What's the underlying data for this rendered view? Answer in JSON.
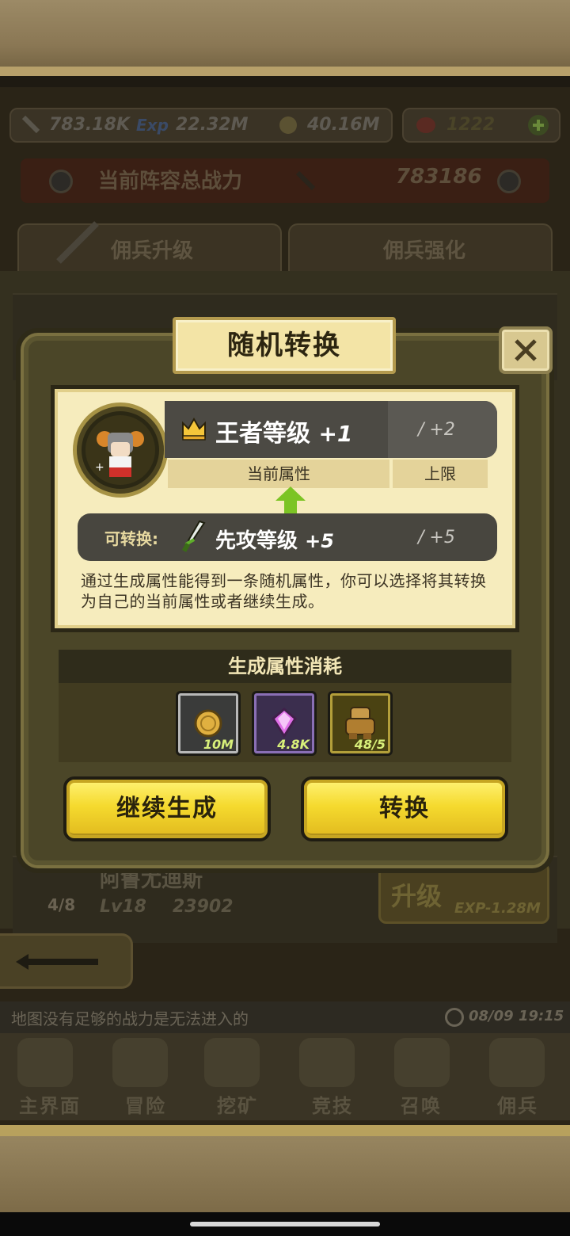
{
  "resources": {
    "power": "783.18K",
    "exp": "22.32M",
    "gold": "40.16M",
    "gems": "1222",
    "exp_tag": "Exp"
  },
  "team_power": {
    "label": "当前阵容总战力",
    "value": "783186"
  },
  "tabs": [
    {
      "label": "佣兵升级"
    },
    {
      "label": "佣兵强化"
    }
  ],
  "background_hero": {
    "name": "阿鲁尤迪斯",
    "count": "4/8",
    "level": "Lv18",
    "power": "23902",
    "upgrade_label": "升级",
    "upgrade_cost": "EXP-1.28M"
  },
  "tip": {
    "text": "地图没有足够的战力是无法进入的",
    "time": "08/09 19:15"
  },
  "bottom_nav": [
    {
      "label": "主界面",
      "icon": "map-scroll-icon"
    },
    {
      "label": "冒险",
      "icon": "island-icon"
    },
    {
      "label": "挖矿",
      "icon": "pickaxe-icon"
    },
    {
      "label": "竞技",
      "icon": "crossed-swords-icon"
    },
    {
      "label": "召唤",
      "icon": "scroll-icon"
    },
    {
      "label": "佣兵",
      "icon": "tent-icon"
    }
  ],
  "modal": {
    "title": "随机转换",
    "current_attr": {
      "name": "王者等级",
      "value": "+1",
      "limit": "/ +2",
      "icon": "crown-icon"
    },
    "current_label": "当前属性",
    "limit_label": "上限",
    "convertible_label": "可转换:",
    "new_attr": {
      "name": "先攻等级",
      "value": "+5",
      "limit": "/ +5",
      "icon": "sword-icon"
    },
    "description": "通过生成属性能得到一条随机属性，你可以选择将其转换为自己的当前属性或者继续生成。",
    "cost_header": "生成属性消耗",
    "costs": [
      {
        "icon": "gold-coin-icon",
        "value": "10M"
      },
      {
        "icon": "purple-gem-icon",
        "value": "4.8K"
      },
      {
        "icon": "golem-icon",
        "value": "48/5"
      }
    ],
    "btn_continue": "继续生成",
    "btn_convert": "转换"
  },
  "colors": {
    "accent_gold": "#f5da2e",
    "card_bg": "#f6ecbd",
    "modal_bg": "#4b4628",
    "value_green": "#d8f07a"
  }
}
